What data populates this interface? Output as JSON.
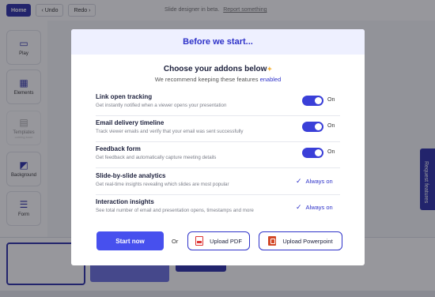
{
  "toolbar": {
    "home_label": "Home",
    "undo_label": "Undo",
    "redo_label": "Redo"
  },
  "topnote": {
    "text": "Slide designer in beta.",
    "link": "Report something"
  },
  "sidebar": {
    "items": [
      {
        "label": "Play"
      },
      {
        "label": "Elements"
      },
      {
        "label": "Templates",
        "sub": "coming soon"
      },
      {
        "label": "Background"
      },
      {
        "label": "Form"
      }
    ]
  },
  "request_tab": {
    "label": "Request features"
  },
  "modal": {
    "title": "Before we start...",
    "heading": "Choose your addons below",
    "subheading_prefix": "We recommend keeping these features",
    "subheading_accent": "enabled",
    "features": [
      {
        "title": "Link open tracking",
        "desc": "Get instantly notified when a viewer opens your presentation",
        "state": "On"
      },
      {
        "title": "Email delivery timeline",
        "desc": "Track viewer emails and verify that your email was sent successfully",
        "state": "On"
      },
      {
        "title": "Feedback form",
        "desc": "Get feedback and automatically capture meeting details",
        "state": "On"
      },
      {
        "title": "Slide-by-slide analytics",
        "desc": "Get real-time insights revealing which slides are most popular",
        "state": "Always on"
      },
      {
        "title": "Interaction insights",
        "desc": "See total number of email and presentation opens, timestamps and more",
        "state": "Always on"
      }
    ],
    "start_label": "Start now",
    "or_label": "Or",
    "upload_pdf_label": "Upload PDF",
    "upload_ppt_label": "Upload Powerpoint"
  },
  "colors": {
    "accent": "#2f33c9",
    "button": "#4750ee",
    "header_bg": "#eef0ff"
  }
}
